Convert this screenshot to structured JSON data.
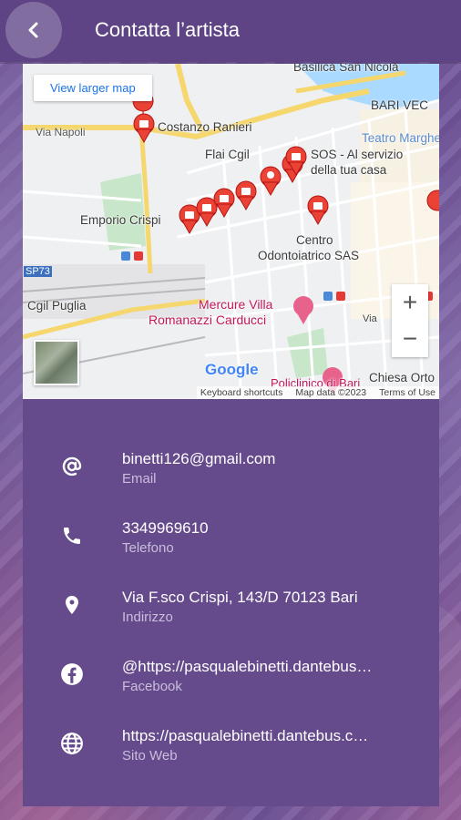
{
  "header": {
    "title": "Contatta l’artista"
  },
  "map": {
    "view_larger": "View larger map",
    "zoom_in": "+",
    "zoom_out": "−",
    "google": "Google",
    "shortcuts": "Keyboard shortcuts",
    "map_data": "Map data ©2023",
    "terms": "Terms of Use",
    "labels": {
      "basilica": "Basilica San Nicola",
      "bari_vec": "BARI VEC",
      "teatro": "Teatro Marghe",
      "via_napoli": "Via Napoli",
      "costanzo": "Costanzo Ranieri",
      "sos": "SOS - Al servizio",
      "sos2": "della tua casa",
      "flai": "Flai Cgil",
      "emporio": "Emporio Crispi",
      "centro": "Centro",
      "centro2": "Odontoiatrico SAS",
      "sp73": "SP73",
      "cgil": "Cgil Puglia",
      "mercure": "Mercure Villa",
      "mercure2": "Romanazzi Carducci",
      "chiesa": "Chiesa Orto",
      "policlinico": "Policlinico di Bari",
      "via": "Via"
    }
  },
  "contacts": [
    {
      "icon": "at-icon",
      "value": "binetti126@gmail.com",
      "label": "Email"
    },
    {
      "icon": "phone-icon",
      "value": "3349969610",
      "label": "Telefono"
    },
    {
      "icon": "location-pin-icon",
      "value": "Via F.sco Crispi, 143/D 70123 Bari",
      "label": "Indirizzo"
    },
    {
      "icon": "facebook-icon",
      "value": "@https://pasqualebinetti.dantebus…",
      "label": "Facebook"
    },
    {
      "icon": "globe-icon",
      "value": "https://pasqualebinetti.dantebus.c…",
      "label": "Sito Web"
    }
  ]
}
